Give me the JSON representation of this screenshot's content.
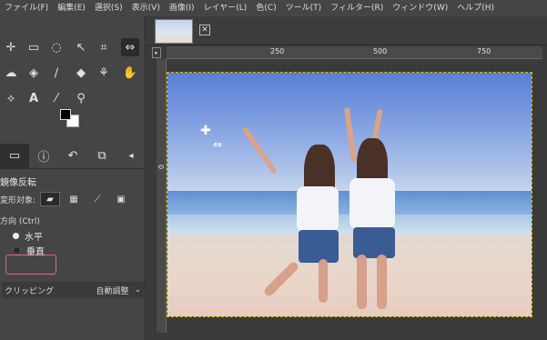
{
  "menu": [
    "ファイル(F)",
    "編集(E)",
    "選択(S)",
    "表示(V)",
    "画像(I)",
    "レイヤー(L)",
    "色(C)",
    "ツール(T)",
    "フィルター(R)",
    "ウィンドウ(W)",
    "ヘルプ(H)"
  ],
  "tool_options": {
    "title": "鏡像反転",
    "transform_label": "変形対象:",
    "direction_label": "方向 (Ctrl)",
    "horizontal_label": "水平",
    "vertical_label": "垂直",
    "clipping_label": "クリッピング",
    "clipping_value": "自動調整"
  },
  "ruler": {
    "t1": "250",
    "t2": "500",
    "t3": "750"
  },
  "ruler_left": {
    "l1": "0"
  },
  "tool_icons": [
    "move-icon",
    "rect-select-icon",
    "lasso-icon",
    "fuzzy-select-icon",
    "crop-icon",
    "transform-icon",
    "warp-icon",
    "bucket-fill-icon",
    "paintbrush-icon",
    "eraser-icon",
    "clone-icon",
    "smudge-icon",
    "paths-icon",
    "text-icon",
    "color-picker-icon",
    "zoom-icon"
  ]
}
